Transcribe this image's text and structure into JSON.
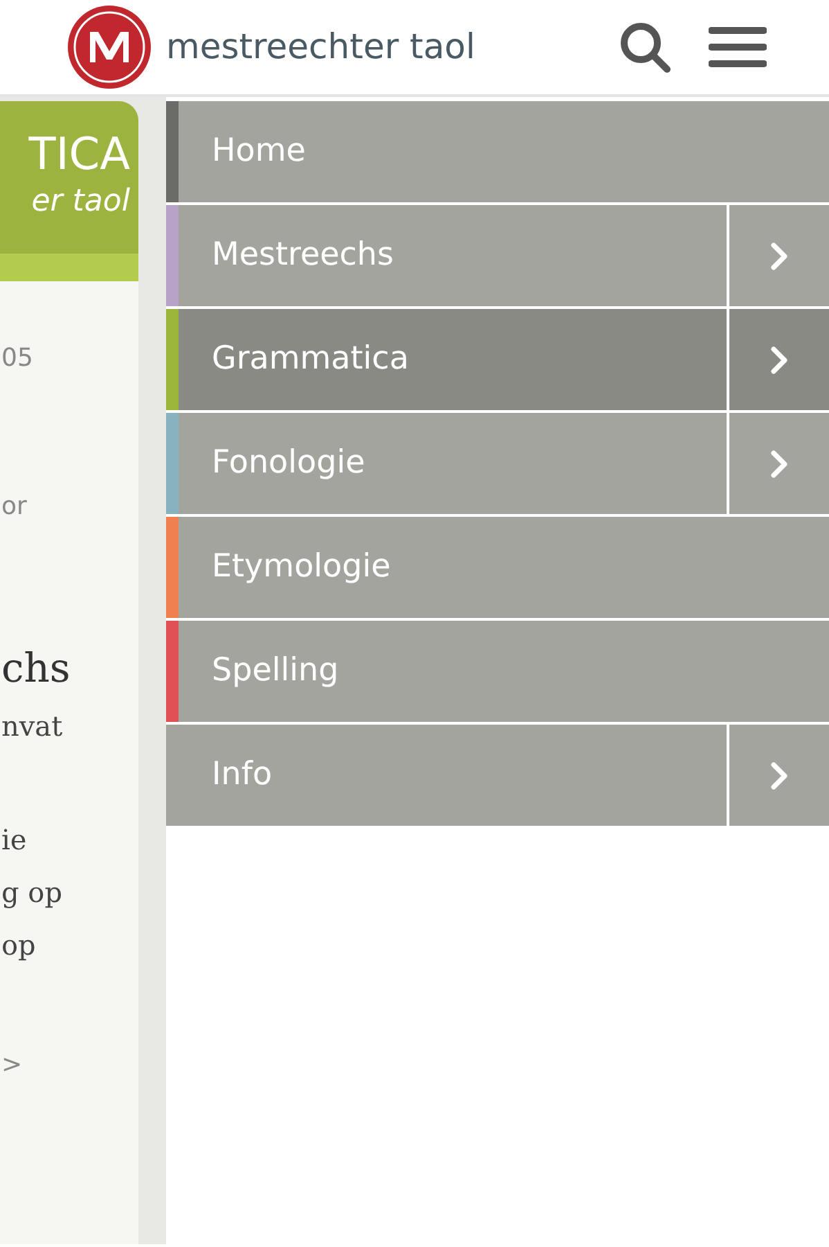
{
  "header": {
    "logo_text": "mestreechter taol"
  },
  "background_page": {
    "banner_title": "TICA",
    "banner_subtitle": "er taol",
    "texts": [
      {
        "kind": "meta",
        "text": "05"
      },
      {
        "kind": "meta",
        "text": "or"
      },
      {
        "kind": "heading",
        "text": "chs"
      },
      {
        "kind": "body",
        "text": "nvat"
      },
      {
        "kind": "body",
        "text": "ie"
      },
      {
        "kind": "body",
        "text": "g op"
      },
      {
        "kind": "body",
        "text": "op"
      },
      {
        "kind": "meta",
        "text": ">"
      }
    ]
  },
  "menu": [
    {
      "label": "Home",
      "color": "#6b6b68",
      "has_submenu": false,
      "selected": false
    },
    {
      "label": "Mestreechs",
      "color": "#b9a2c8",
      "has_submenu": true,
      "selected": false
    },
    {
      "label": "Grammatica",
      "color": "#9ab53a",
      "has_submenu": true,
      "selected": true
    },
    {
      "label": "Fonologie",
      "color": "#86b3bd",
      "has_submenu": true,
      "selected": false
    },
    {
      "label": "Etymologie",
      "color": "#f08050",
      "has_submenu": false,
      "selected": false
    },
    {
      "label": "Spelling",
      "color": "#e05055",
      "has_submenu": false,
      "selected": false
    },
    {
      "label": "Info",
      "color": "#a4a49f",
      "has_submenu": true,
      "selected": false
    }
  ]
}
